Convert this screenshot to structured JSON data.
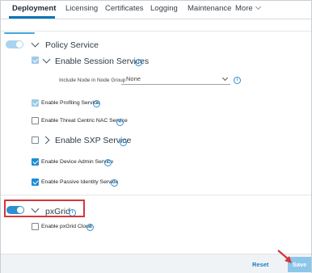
{
  "tabs": [
    {
      "label": "Deployment"
    },
    {
      "label": "Licensing"
    },
    {
      "label": "Certificates"
    },
    {
      "label": "Logging"
    },
    {
      "label": "Maintenance"
    },
    {
      "label": "More"
    }
  ],
  "policy_service": {
    "label": "Policy Service",
    "enable_session_services": {
      "label": "Enable Session Services",
      "node_group": {
        "label": "Include Node in Node Group",
        "value": "None"
      }
    },
    "profiling": {
      "label": "Enable Profiling Service",
      "checked": true
    },
    "threat_centric_nac": {
      "label": "Enable Threat Centric NAC Service",
      "checked": false
    },
    "sxp": {
      "label": "Enable SXP Service"
    },
    "device_admin": {
      "label": "Enable Device Admin Service",
      "checked": true
    },
    "passive_identity": {
      "label": "Enable Passive Identity Service",
      "checked": true
    }
  },
  "pxgrid": {
    "label": "pxGrid",
    "cloud": {
      "label": "Enable pxGrid Cloud",
      "checked": false
    }
  },
  "footer": {
    "reset_label": "Reset",
    "save_label": "Save"
  },
  "info_glyph": "i",
  "colors": {
    "accent": "#1b8fd6",
    "highlight": "#d4363c",
    "save_disabled": "#8cc6ea"
  }
}
